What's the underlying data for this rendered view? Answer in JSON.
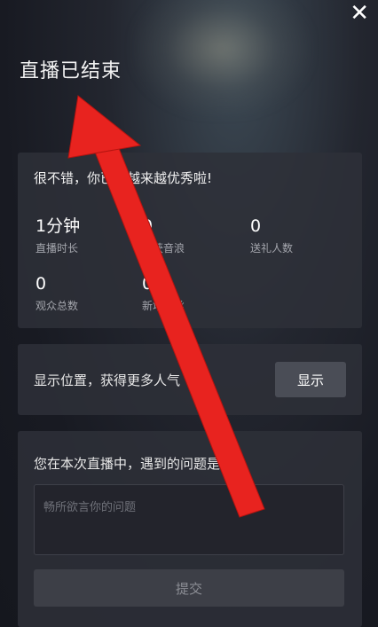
{
  "header": {
    "title": "直播已结束",
    "close_icon": "close-icon"
  },
  "stats_card": {
    "heading": "很不错，你已经越来越优秀啦!",
    "stats": [
      {
        "value": "1分钟",
        "label": "直播时长"
      },
      {
        "value": "0",
        "label": "收获音浪"
      },
      {
        "value": "0",
        "label": "送礼人数"
      },
      {
        "value": "0",
        "label": "观众总数"
      },
      {
        "value": "0",
        "label": "新增粉丝"
      }
    ]
  },
  "location_card": {
    "text": "显示位置，获得更多人气",
    "button_label": "显示"
  },
  "question_card": {
    "heading": "您在本次直播中，遇到的问题是?",
    "input_placeholder": "畅所欲言你的问题",
    "submit_label": "提交"
  },
  "annotation": {
    "type": "red-arrow",
    "color": "#e8231f"
  }
}
